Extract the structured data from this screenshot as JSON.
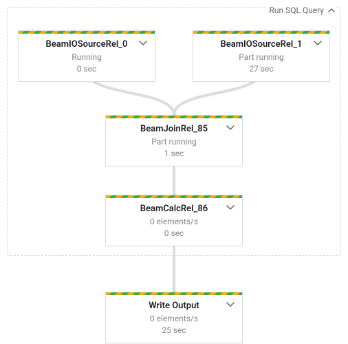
{
  "group": {
    "title": "Run SQL Query"
  },
  "nodes": {
    "n0": {
      "title": "BeamIOSourceRel_0",
      "status": "Running",
      "meta": "0 sec"
    },
    "n1": {
      "title": "BeamIOSourceRel_1",
      "status": "Part running",
      "meta": "27 sec"
    },
    "n2": {
      "title": "BeamJoinRel_85",
      "status": "Part running",
      "meta": "1 sec"
    },
    "n3": {
      "title": "BeamCalcRel_86",
      "status": "0 elements/s",
      "meta": "0 sec"
    },
    "n4": {
      "title": "Write Output",
      "status": "0 elements/s",
      "meta": "25 sec"
    }
  }
}
